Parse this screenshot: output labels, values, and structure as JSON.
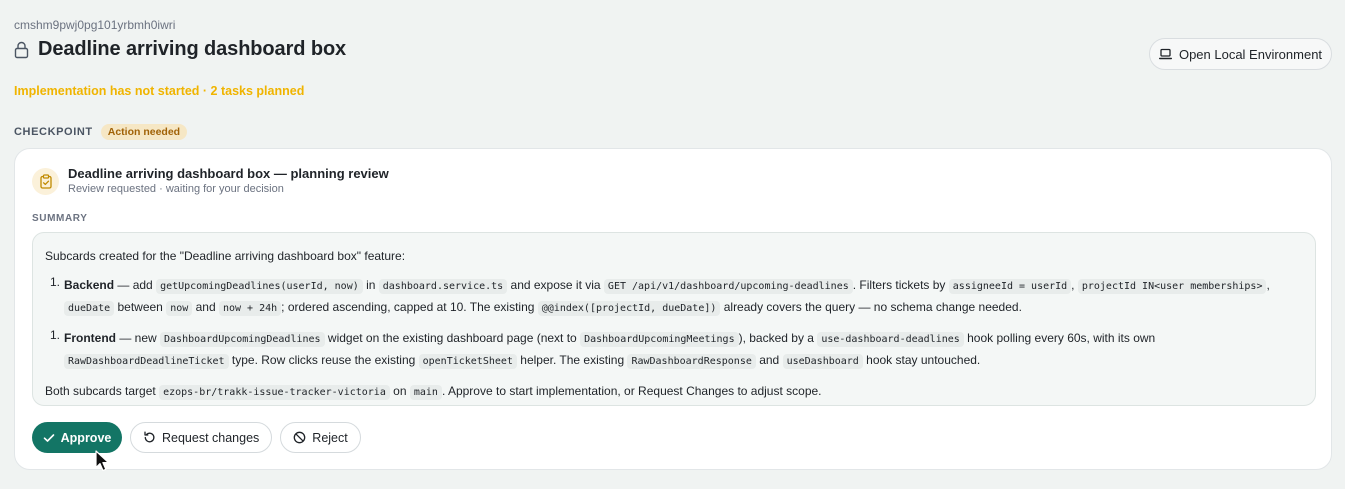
{
  "header": {
    "issue_id": "cmshm9pwj0pg101yrbmh0iwri",
    "title": "Deadline arriving dashboard box",
    "lock_icon": "lock-icon",
    "open_env_label": "Open Local Environment",
    "open_env_icon": "laptop-icon"
  },
  "status": {
    "text": "Implementation has not started · 2 tasks planned",
    "color": "#f0b400"
  },
  "checkpoint": {
    "label": "CHECKPOINT",
    "badge": "Action needed"
  },
  "card": {
    "icon": "clipboard-check-icon",
    "title": "Deadline arriving dashboard box — planning review",
    "subtitle": "Review requested · waiting for your decision",
    "summary_label": "SUMMARY",
    "summary": {
      "intro": "Subcards created for the \"Deadline arriving dashboard box\" feature:",
      "step1": {
        "num": "1.",
        "name": "Backend",
        "t1": " — add ",
        "c1": "getUpcomingDeadlines(userId, now)",
        "t2": " in ",
        "c2": "dashboard.service.ts",
        "t3": " and expose it via ",
        "c3": "GET /api/v1/dashboard/upcoming-deadlines",
        "t4": ". Filters tickets by ",
        "c4": "assigneeId = userId",
        "t5": ", ",
        "c5": "projectId IN<user memberships>",
        "t6": ", ",
        "c6": "dueDate",
        "t7": " between ",
        "c7": "now",
        "t8": " and ",
        "c8": "now + 24h",
        "t9": "; ordered ascending, capped at 10. The existing ",
        "c9": "@@index([projectId, dueDate])",
        "t10": " already covers the query — no schema change needed."
      },
      "step2": {
        "num": "1.",
        "name": "Frontend",
        "t1": " — new ",
        "c1": "DashboardUpcomingDeadlines",
        "t2": " widget on the existing dashboard page (next to ",
        "c2": "DashboardUpcomingMeetings",
        "t3": "), backed by a ",
        "c3": "use-dashboard-deadlines",
        "t4": " hook polling every 60s, with its own ",
        "c4": "RawDashboardDeadlineTicket",
        "t5": " type. Row clicks reuse the existing ",
        "c5": "openTicketSheet",
        "t6": " helper. The existing ",
        "c6": "RawDashboardResponse",
        "t7": " and ",
        "c7": "useDashboard",
        "t8": " hook stay untouched."
      },
      "outro": {
        "t1": "Both subcards target ",
        "c1": "ezops-br/trakk-issue-tracker-victoria",
        "t2": " on ",
        "c2": "main",
        "t3": ". Approve to start implementation, or Request Changes to adjust scope."
      }
    }
  },
  "actions": {
    "approve": "Approve",
    "request_changes": "Request changes",
    "reject": "Reject",
    "approve_color": "#137565"
  }
}
